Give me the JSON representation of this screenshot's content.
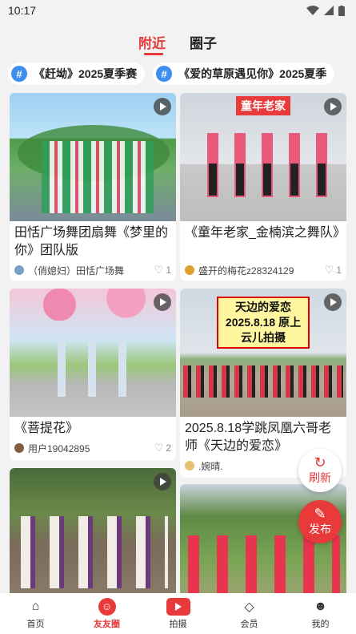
{
  "status": {
    "time": "10:17",
    "icons": [
      "wifi-icon",
      "signal-icon",
      "battery-icon"
    ]
  },
  "tabs": [
    {
      "label": "附近",
      "active": true
    },
    {
      "label": "圈子",
      "active": false
    }
  ],
  "topics": [
    "《赶坳》2025夏季赛",
    "《爱的草原遇见你》2025夏季"
  ],
  "posts": [
    {
      "title": "田恬广场舞团扇舞《梦里的你》团队版",
      "author": "（俏媳妇）田恬广场舞",
      "likes": "1"
    },
    {
      "title": "《童年老家_金楠滨之舞队》",
      "author": "盛开的梅花z28324129",
      "likes": "1",
      "sign": "童年老家"
    },
    {
      "title": "《菩提花》",
      "author": "用户19042895",
      "likes": "2"
    },
    {
      "title": "2025.8.18学跳凤凰六哥老师《天边的爱恋》",
      "author": ".婉晴.",
      "likes": "",
      "banner": "天边的爱恋 2025.8.18 原上云儿拍摄"
    },
    {
      "title": "",
      "author": "",
      "likes": ""
    },
    {
      "title": "",
      "author": "",
      "likes": ""
    }
  ],
  "fab": {
    "refresh": "刷新",
    "publish": "发布"
  },
  "nav": [
    "首页",
    "友友圈",
    "拍摄",
    "会员",
    "我的"
  ],
  "colors": {
    "accent": "#e83a3a",
    "topic_hash": "#3d8ef0"
  }
}
